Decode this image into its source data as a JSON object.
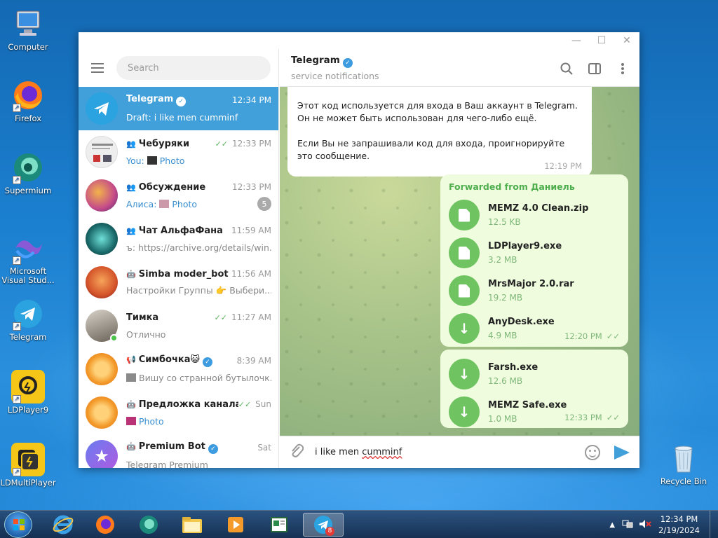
{
  "desktop": {
    "icons": [
      {
        "label": "Computer"
      },
      {
        "label": "Firefox"
      },
      {
        "label": "Supermium"
      },
      {
        "label": "Microsoft Visual Stud..."
      },
      {
        "label": "Telegram"
      },
      {
        "label": "LDPlayer9"
      },
      {
        "label": "LDMultiPlayer"
      },
      {
        "label": "Recycle Bin"
      }
    ]
  },
  "window": {
    "controls": {
      "minimize": "—",
      "maximize": "☐",
      "close": "✕"
    }
  },
  "sidebar": {
    "search_placeholder": "Search",
    "chats": [
      {
        "name": "Telegram",
        "time": "12:34 PM",
        "prefix": "Draft: ",
        "preview": "i like men cumminf",
        "verified": true,
        "active": true
      },
      {
        "name": "Чебуряки",
        "time": "12:33 PM",
        "prefix": "You: ",
        "preview": "Photo",
        "group": true,
        "read": true
      },
      {
        "name": "Обсуждение",
        "time": "12:33 PM",
        "prefix": "Алиса: ",
        "preview": "Photo",
        "group": true,
        "unread": "5"
      },
      {
        "name": "Чат АльфаФана",
        "time": "11:59 AM",
        "prefix": "",
        "preview": "ъ: https://archive.org/details/win...",
        "group": true
      },
      {
        "name": "Simba moder_bot",
        "time": "11:56 AM",
        "prefix": "",
        "preview": "Настройки Группы 👉 Выбери...",
        "bot": true
      },
      {
        "name": "Тимка",
        "time": "11:27 AM",
        "prefix": "",
        "preview": "Отлично",
        "read": true,
        "online": true
      },
      {
        "name": "Симбочка😺",
        "time": "8:39 AM",
        "prefix": "",
        "preview": "Вишу со странной бутылочк...",
        "channel": true,
        "verified": true
      },
      {
        "name": "Предложка канала ...",
        "time": "Sun",
        "prefix": "",
        "preview": "Photo",
        "bot": true,
        "read": true
      },
      {
        "name": "Premium Bot",
        "time": "Sat",
        "prefix": "",
        "preview": "Telegram Premium",
        "bot": true,
        "verified": true
      }
    ]
  },
  "chat_header": {
    "title": "Telegram",
    "subtitle": "service notifications"
  },
  "messages": {
    "incoming": {
      "para1": "Этот код используется для входа в Ваш аккаунт в Telegram. Он не может быть использован для чего-либо ещё.",
      "para2": "Если Вы не запрашивали код для входа, проигнорируйте это сообщение.",
      "time": "12:19 PM"
    },
    "forwarded_label": "Forwarded from Даниель",
    "group1": {
      "time": "12:20 PM",
      "files": [
        {
          "name": "MEMZ 4.0 Clean.zip",
          "size": "12.5 KB",
          "icon": "file-icon"
        },
        {
          "name": "LDPlayer9.exe",
          "size": "3.2 MB",
          "icon": "file-icon"
        },
        {
          "name": "MrsMajor 2.0.rar",
          "size": "19.2 MB",
          "icon": "file-icon"
        },
        {
          "name": "AnyDesk.exe",
          "size": "4.9 MB",
          "icon": "download-icon"
        }
      ]
    },
    "group2": {
      "time": "12:33 PM",
      "files": [
        {
          "name": "Farsh.exe",
          "size": "12.6 MB",
          "icon": "download-icon"
        },
        {
          "name": "MEMZ Safe.exe",
          "size": "1.0 MB",
          "icon": "download-icon"
        }
      ]
    }
  },
  "compose": {
    "text_start": "i like men ",
    "text_misspelled": "cumminf"
  },
  "taskbar": {
    "time": "12:34 PM",
    "date": "2/19/2024",
    "telegram_badge": "8"
  }
}
